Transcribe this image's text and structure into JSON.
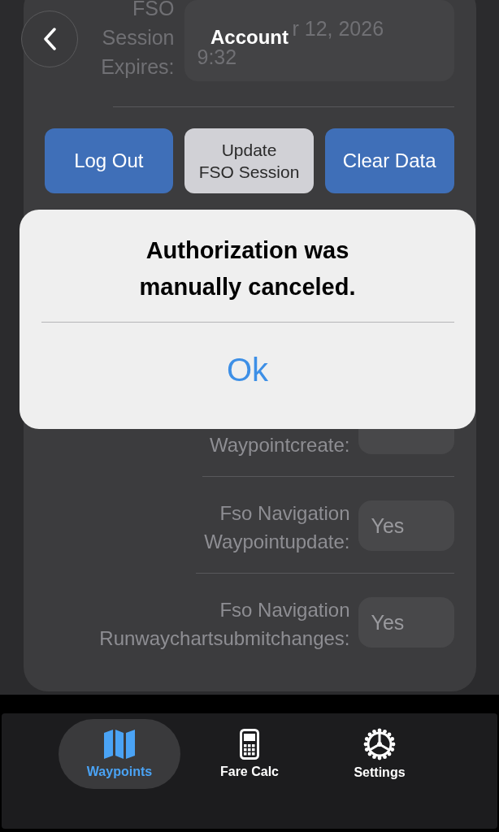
{
  "header": {
    "title": "Account"
  },
  "session": {
    "label": "FSO Session Expires:",
    "date_fragment": "r 12, 2026",
    "time": "9:32"
  },
  "buttons": [
    {
      "label": "Log Out",
      "kind": "primary"
    },
    {
      "label": "Update\nFSO Session",
      "kind": "secondary"
    },
    {
      "label": "Clear Data",
      "kind": "primary"
    }
  ],
  "permissions": [
    {
      "label": "Waypointcreate:"
    },
    {
      "label": "Fso Navigation\nWaypointupdate:",
      "value": "Yes"
    },
    {
      "label": "Fso Navigation\nRunwaychartsubmitchanges:",
      "value": "Yes"
    }
  ],
  "alert": {
    "message": "Authorization was\nmanually canceled.",
    "action": "Ok"
  },
  "tabs": [
    {
      "label": "Waypoints",
      "kind": "map",
      "selected": true
    },
    {
      "label": "Fare Calc",
      "kind": "calculator",
      "selected": false
    },
    {
      "label": "Settings",
      "kind": "gear",
      "selected": false
    }
  ]
}
